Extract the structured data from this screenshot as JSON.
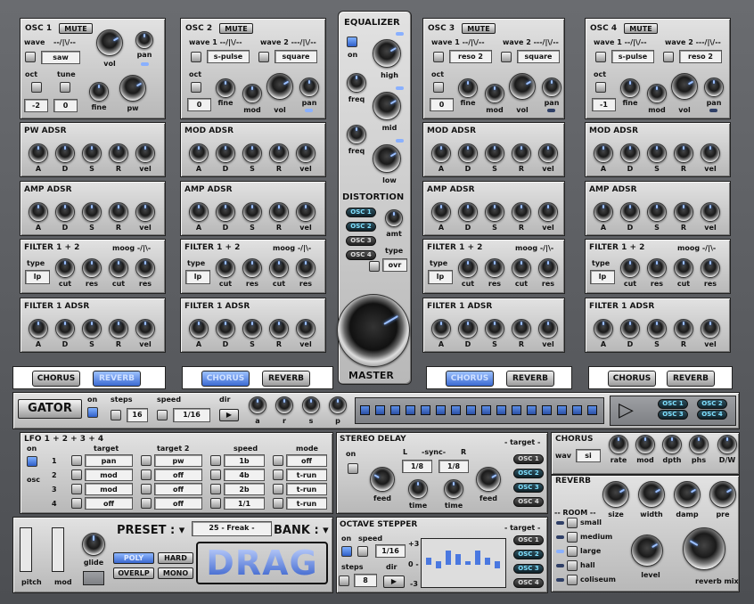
{
  "oscillators": [
    {
      "title": "OSC 1",
      "mute": "MUTE",
      "wave_label": "wave",
      "wave_sym": "--/|\\/--",
      "wave1_val": "saw",
      "oct_label": "oct",
      "oct_val": "-2",
      "tune_label": "tune",
      "tune_val": "0",
      "fine": "fine",
      "pw": "pw",
      "vol": "vol",
      "pan": "pan"
    },
    {
      "title": "OSC 2",
      "mute": "MUTE",
      "wave1_label": "wave  1 --/|\\/--",
      "wave2_label": "wave  2 ---/|\\/--",
      "wave1_val": "s-pulse",
      "wave2_val": "square",
      "oct_label": "oct",
      "oct_val": "0",
      "fine": "fine",
      "mod": "mod",
      "vol": "vol",
      "pan": "pan"
    },
    {
      "title": "OSC 3",
      "mute": "MUTE",
      "wave1_label": "wave  1 --/|\\/--",
      "wave2_label": "wave  2 ---/|\\/--",
      "wave1_val": "reso 2",
      "wave2_val": "square",
      "oct_label": "oct",
      "oct_val": "0",
      "fine": "fine",
      "mod": "mod",
      "vol": "vol",
      "pan": "pan"
    },
    {
      "title": "OSC 4",
      "mute": "MUTE",
      "wave1_label": "wave  1 --/|\\/--",
      "wave2_label": "wave  2 ---/|\\/--",
      "wave1_val": "s-pulse",
      "wave2_val": "reso 2",
      "oct_label": "oct",
      "oct_val": "-1",
      "fine": "fine",
      "mod": "mod",
      "vol": "vol",
      "pan": "pan"
    }
  ],
  "sections": {
    "pw_adsr": "PW ADSR",
    "mod_adsr": "MOD ADSR",
    "amp_adsr": "AMP ADSR",
    "filter12": "FILTER 1 + 2",
    "filter_type_sym": "moog -/|\\-",
    "filter1_adsr": "FILTER 1 ADSR",
    "type": "type",
    "type_val": "lp",
    "cut": "cut",
    "res": "res"
  },
  "adsr_labels": [
    "A",
    "D",
    "S",
    "R",
    "vel"
  ],
  "equalizer": {
    "title": "EQUALIZER",
    "on": "on",
    "high": "high",
    "freq1": "freq",
    "mid": "mid",
    "freq2": "freq",
    "low": "low"
  },
  "distortion": {
    "title": "DISTORTION",
    "osc": [
      "OSC 1",
      "OSC 2",
      "OSC 3",
      "OSC 4"
    ],
    "amt": "amt",
    "type": "type",
    "type_val": "ovr"
  },
  "master": "MASTER",
  "fx": {
    "chorus": "CHORUS",
    "reverb": "REVERB"
  },
  "gator": {
    "title": "GATOR",
    "on": "on",
    "steps": "steps",
    "steps_val": "16",
    "speed": "speed",
    "speed_val": "1/16",
    "dir": "dir",
    "a": "a",
    "r": "r",
    "s": "s",
    "p": "p",
    "osc": [
      "OSC 1",
      "OSC 2",
      "OSC 3",
      "OSC 4"
    ]
  },
  "lfo": {
    "title": "LFO 1 + 2 + 3 + 4",
    "on": "on",
    "osc": "osc",
    "target": "target",
    "target2": "target 2",
    "speed": "speed",
    "mode": "mode",
    "rows": [
      {
        "n": "1",
        "t": "pan",
        "t2": "pw",
        "sp": "1b",
        "m": "off"
      },
      {
        "n": "2",
        "t": "mod",
        "t2": "off",
        "sp": "4b",
        "m": "t-run"
      },
      {
        "n": "3",
        "t": "mod",
        "t2": "off",
        "sp": "2b",
        "m": "t-run"
      },
      {
        "n": "4",
        "t": "off",
        "t2": "off",
        "sp": "1/1",
        "m": "t-run"
      }
    ]
  },
  "stereo_delay": {
    "title": "STEREO DELAY",
    "on": "on",
    "L": "L",
    "sync": "-sync-",
    "R": "R",
    "l_val": "1/8",
    "r_val": "1/8",
    "feed": "feed",
    "time": "time",
    "time2": "time",
    "feed2": "feed",
    "target": "- target -",
    "osc": [
      "OSC 1",
      "OSC 2",
      "OSC 3",
      "OSC 4"
    ]
  },
  "chorus_panel": {
    "title": "CHORUS",
    "wav": "wav",
    "wav_val": "si",
    "rate": "rate",
    "mod": "mod",
    "dpth": "dpth",
    "phs": "phs",
    "dw": "D/W"
  },
  "reverb_panel": {
    "title": "REVERB",
    "size": "size",
    "width": "width",
    "damp": "damp",
    "pre": "pre",
    "room": "-- ROOM --",
    "rooms": [
      "small",
      "medium",
      "large",
      "hall",
      "coliseum"
    ],
    "level": "level",
    "mix": "reverb mix"
  },
  "preset": {
    "label": "PRESET : ▾",
    "value": "25 - Freak -",
    "bank": "BANK : ▾",
    "poly": "POLY",
    "hard": "HARD",
    "overlap": "OVERLP",
    "mono": "MONO",
    "glide": "glide",
    "pitch": "pitch",
    "mod": "mod",
    "logo": "DRAG"
  },
  "octave_stepper": {
    "title": "OCTAVE STEPPER",
    "on": "on",
    "speed": "speed",
    "speed_val": "1/16",
    "steps": "steps",
    "steps_val": "8",
    "dir": "dir",
    "p3": "+3",
    "zero": "0 -",
    "m3": "-3",
    "target": "- target -",
    "osc": [
      "OSC 1",
      "OSC 2",
      "OSC 3",
      "OSC 4"
    ],
    "levels": [
      0.1,
      -0.1,
      0.3,
      0.2,
      0.0,
      0.3,
      0.1,
      -0.1
    ]
  }
}
